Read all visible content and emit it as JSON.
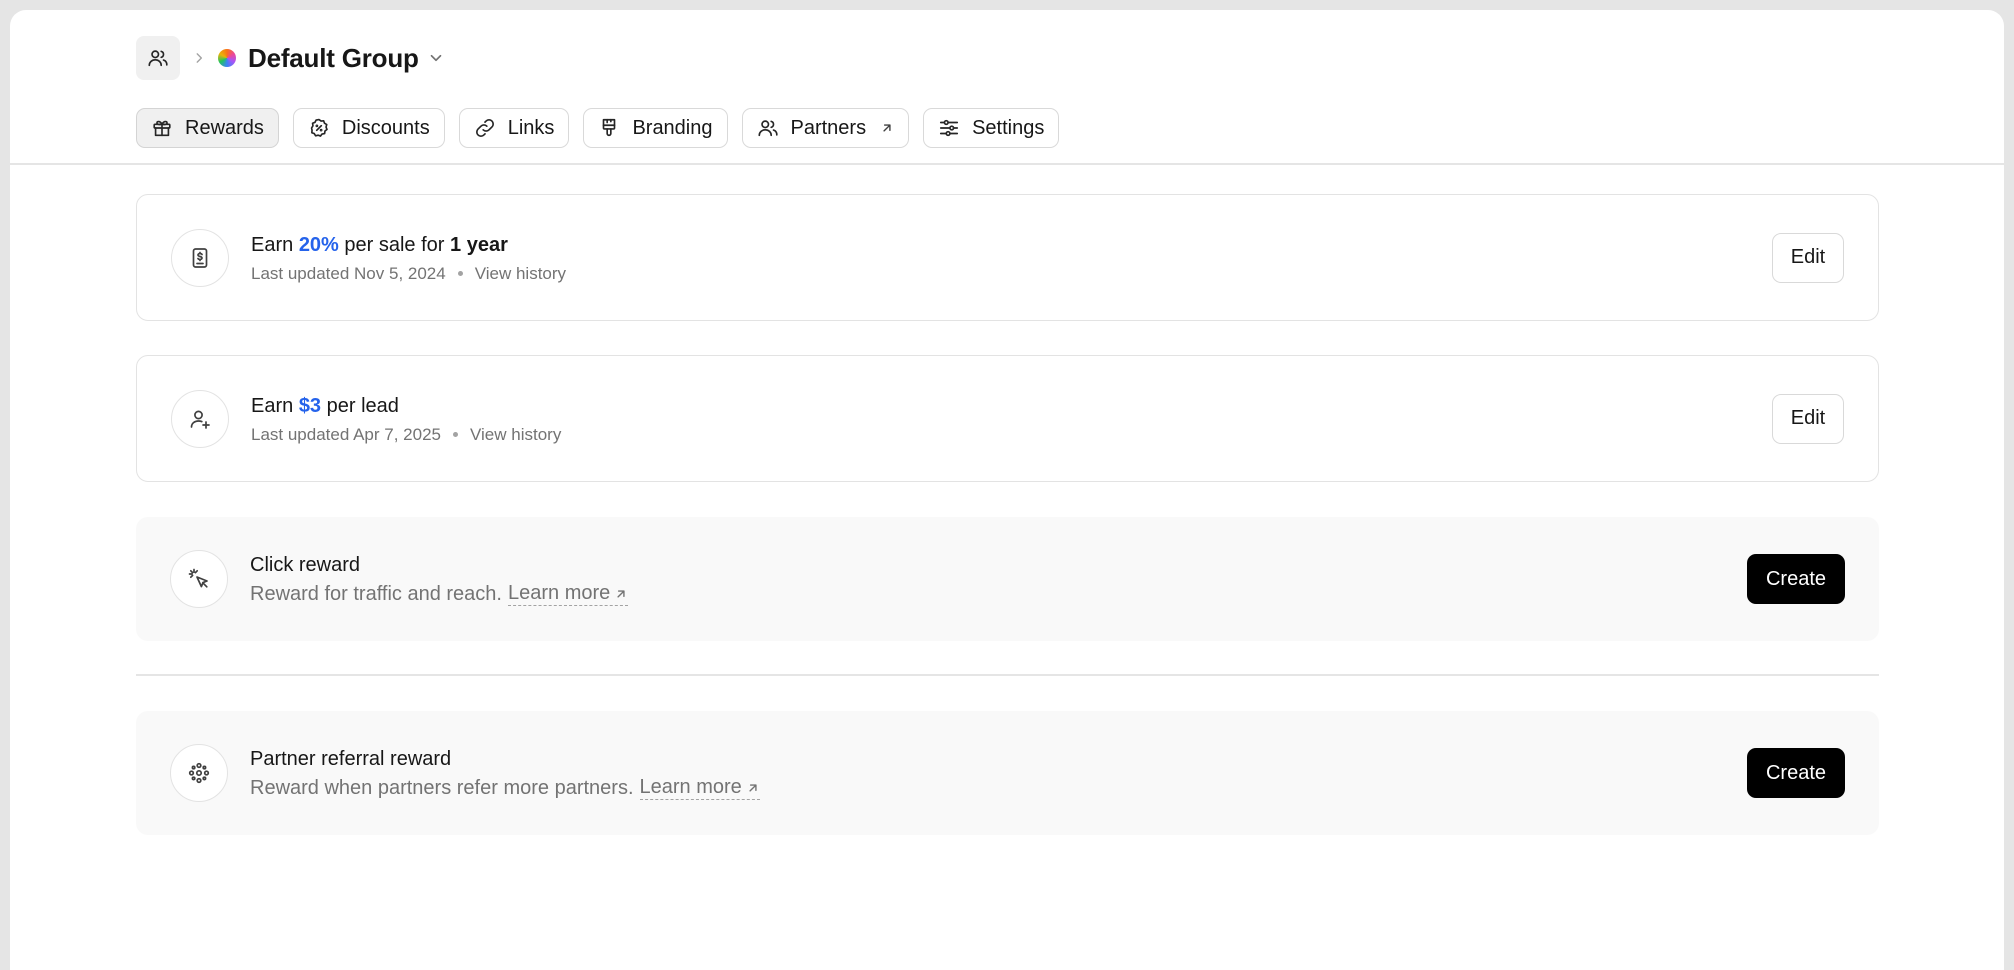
{
  "breadcrumb": {
    "home_icon": "users-icon",
    "group_name": "Default Group"
  },
  "tabs": [
    {
      "label": "Rewards",
      "icon": "gift-icon",
      "active": true
    },
    {
      "label": "Discounts",
      "icon": "discount-badge-icon",
      "active": false
    },
    {
      "label": "Links",
      "icon": "link-icon",
      "active": false
    },
    {
      "label": "Branding",
      "icon": "paint-brush-icon",
      "active": false
    },
    {
      "label": "Partners",
      "icon": "users-icon",
      "active": false,
      "external": true
    },
    {
      "label": "Settings",
      "icon": "sliders-icon",
      "active": false
    }
  ],
  "rewards": [
    {
      "icon": "receipt-dollar-icon",
      "title_prefix": "Earn ",
      "amount": "20%",
      "title_mid": " per sale for ",
      "duration": "1 year",
      "last_updated": "Last updated Nov 5, 2024",
      "history_label": "View history",
      "action_label": "Edit"
    },
    {
      "icon": "user-plus-icon",
      "title_prefix": "Earn ",
      "amount": "$3",
      "title_mid": " per lead",
      "last_updated": "Last updated Apr 7, 2025",
      "history_label": "View history",
      "action_label": "Edit"
    }
  ],
  "click_reward": {
    "icon": "cursor-click-icon",
    "title": "Click reward",
    "description": "Reward for traffic and reach.",
    "learn_more": "Learn more",
    "action_label": "Create"
  },
  "partner_referral_reward": {
    "icon": "network-icon",
    "title": "Partner referral reward",
    "description": "Reward when partners refer more partners.",
    "learn_more": "Learn more",
    "action_label": "Create"
  },
  "colors": {
    "accent": "#2563eb",
    "primary_button": "#000000",
    "muted_text": "#737373"
  }
}
